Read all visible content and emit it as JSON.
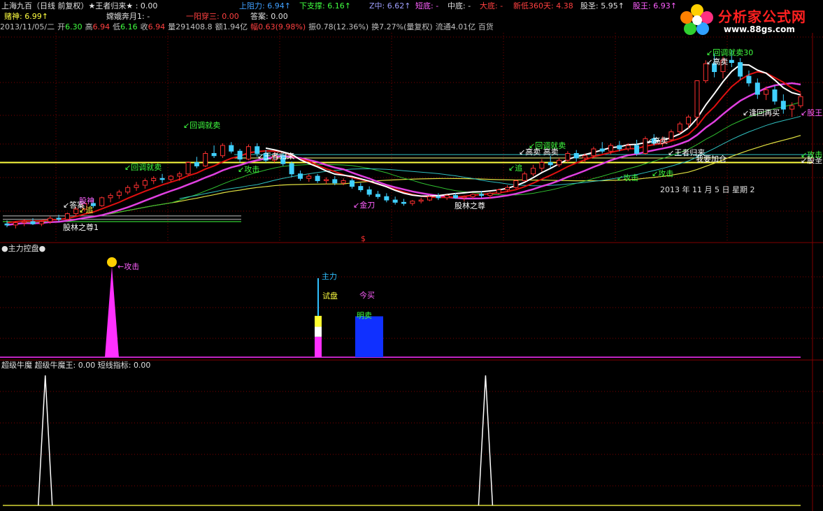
{
  "header": {
    "row1": [
      {
        "label": "上海九百（日线 前复权）★王者归来★",
        "value": ": 0.00",
        "color": "#e0e0e0"
      },
      {
        "label": "上阻力:",
        "value": "6.94",
        "arrow": "↑",
        "color": "#40a0ff"
      },
      {
        "label": "下支撑:",
        "value": "6.16",
        "arrow": "↑",
        "color": "#40ff40"
      },
      {
        "label": "Z中:",
        "value": "6.62",
        "arrow": "↑",
        "color": "#a0a0ff"
      },
      {
        "label": "短底:",
        "value": "-",
        "color": "#ff60ff"
      },
      {
        "label": "中底:",
        "value": "-",
        "color": "#e0e0e0"
      },
      {
        "label": "大底:",
        "value": "-",
        "color": "#ff4040"
      },
      {
        "label": "新低360天:",
        "value": "4.38",
        "color": "#ff4040"
      },
      {
        "label": "股圣:",
        "value": "5.95",
        "arrow": "↑",
        "color": "#e0e0e0"
      },
      {
        "label": "股王:",
        "value": "6.93",
        "arrow": "↑",
        "color": "#ff60ff"
      }
    ],
    "row2": [
      {
        "label": "赌神:",
        "value": "6.99",
        "arrow": "↑",
        "color": "#ffff40"
      },
      {
        "label": "嫦娥奔月1:",
        "value": "-",
        "color": "#e0e0e0"
      },
      {
        "label": "一阳穿三:",
        "value": "0.00",
        "color": "#ff4040"
      },
      {
        "label": "答案:",
        "value": "0.00",
        "color": "#e0e0e0"
      }
    ],
    "row3": {
      "date": "2013/11/05/二",
      "open_label": "开",
      "open": "6.30",
      "high_label": "高",
      "high": "6.94",
      "low_label": "低",
      "low": "6.16",
      "close_label": "收",
      "close": "6.94",
      "volume": "量291408.8",
      "amount": "额1.94亿",
      "change": "幅0.63(9.98%)",
      "amplitude": "振0.78(12.36%)",
      "turnover": "换7.27%(量复权)",
      "float": "流通4.01亿 百货"
    }
  },
  "logo": {
    "title": "分析家公式网",
    "url": "www.88gs.com"
  },
  "main_labels": [
    {
      "text": "↙答案",
      "color": "#ffffff",
      "k": "a1"
    },
    {
      "text": "股神",
      "color": "#ff60ff",
      "k": "a2"
    },
    {
      "text": "↙追",
      "color": "#ffff40",
      "k": "a3"
    },
    {
      "text": "股林之尊1",
      "color": "#ffffff",
      "k": "a4"
    },
    {
      "text": "↙回调就卖",
      "color": "#40ff40",
      "k": "a5"
    },
    {
      "text": "↙回调就卖",
      "color": "#40ff40",
      "k": "a6"
    },
    {
      "text": "↙王者归来",
      "color": "#ffffff",
      "k": "a7"
    },
    {
      "text": "↙金刀",
      "color": "#ff60ff",
      "k": "a8"
    },
    {
      "text": "$",
      "color": "#ff3030",
      "k": "a9"
    },
    {
      "text": "股林之尊",
      "color": "#ffffff",
      "k": "a10"
    },
    {
      "text": "↙回调就卖",
      "color": "#40ff40",
      "k": "a11"
    },
    {
      "text": "↙高卖 高卖",
      "color": "#ffffff",
      "k": "a12"
    },
    {
      "text": "↙追",
      "color": "#40ff40",
      "k": "a13"
    },
    {
      "text": "↙高卖",
      "color": "#ffffff",
      "k": "a14"
    },
    {
      "text": "↙回调就卖30",
      "color": "#40ff40",
      "k": "a15"
    },
    {
      "text": "↙高卖",
      "color": "#ffffff",
      "k": "a16"
    },
    {
      "text": "↙王者归来",
      "color": "#ffffff",
      "k": "a17"
    },
    {
      "text": "我要加仓",
      "color": "#ffffff",
      "k": "a18"
    },
    {
      "text": "↙攻击",
      "color": "#40ff40",
      "k": "a19"
    },
    {
      "text": "↙攻击",
      "color": "#40ff40",
      "k": "a20"
    },
    {
      "text": "↙逢回再买",
      "color": "#ffffff",
      "k": "a21"
    },
    {
      "text": "↙股王",
      "color": "#ff60ff",
      "k": "a22"
    },
    {
      "text": "↙攻击",
      "color": "#40ff40",
      "k": "a23"
    },
    {
      "text": "↙股圣",
      "color": "#ffffff",
      "k": "a24"
    },
    {
      "text": "↙攻击",
      "color": "#40ff40",
      "k": "a25"
    }
  ],
  "date_readout": "2013 年 11 月 5 日  星期  2",
  "pane2": {
    "title": "●主力控盘●",
    "labels": {
      "attack": "←攻击",
      "zhuli": "主力",
      "shipan": "试盘",
      "jinmai": "今买",
      "mingmai": "明卖"
    }
  },
  "pane3": {
    "title": "超级牛魔",
    "item1_label": "超级牛魔王:",
    "item1_value": "0.00",
    "item2_label": "短线指标:",
    "item2_value": "0.00"
  },
  "colors": {
    "up": "#ff3030",
    "down": "#40d0ff",
    "bg": "#000000",
    "grid": "#800000",
    "ma_red": "#e01010",
    "ma_magenta": "#e040e0",
    "ma_white": "#ffffff",
    "ma_green": "#30c030",
    "ma_yellow": "#e0e040",
    "ma_cyan": "#30c0c0"
  },
  "chart_data": [
    {
      "type": "candlestick",
      "title": "上海九百（日线 前复权）",
      "ohlc": [
        [
          4.42,
          4.48,
          4.36,
          4.4
        ],
        [
          4.4,
          4.46,
          4.34,
          4.44
        ],
        [
          4.44,
          4.5,
          4.38,
          4.46
        ],
        [
          4.46,
          4.52,
          4.4,
          4.42
        ],
        [
          4.42,
          4.48,
          4.38,
          4.46
        ],
        [
          4.46,
          4.56,
          4.42,
          4.52
        ],
        [
          4.52,
          4.58,
          4.46,
          4.5
        ],
        [
          4.5,
          4.62,
          4.48,
          4.6
        ],
        [
          4.6,
          4.72,
          4.56,
          4.68
        ],
        [
          4.68,
          4.8,
          4.64,
          4.78
        ],
        [
          4.78,
          4.86,
          4.7,
          4.74
        ],
        [
          4.74,
          4.9,
          4.72,
          4.88
        ],
        [
          4.88,
          4.96,
          4.8,
          4.92
        ],
        [
          4.92,
          5.02,
          4.86,
          4.98
        ],
        [
          4.98,
          5.1,
          4.94,
          5.06
        ],
        [
          5.06,
          5.16,
          5.0,
          5.1
        ],
        [
          5.1,
          5.22,
          5.04,
          5.18
        ],
        [
          5.18,
          5.26,
          5.12,
          5.22
        ],
        [
          5.22,
          5.3,
          5.14,
          5.2
        ],
        [
          5.2,
          5.28,
          5.16,
          5.26
        ],
        [
          5.26,
          5.34,
          5.18,
          5.3
        ],
        [
          5.3,
          5.52,
          5.28,
          5.5
        ],
        [
          5.5,
          5.6,
          5.4,
          5.44
        ],
        [
          5.44,
          5.7,
          5.42,
          5.66
        ],
        [
          5.66,
          5.8,
          5.58,
          5.62
        ],
        [
          5.62,
          5.84,
          5.58,
          5.8
        ],
        [
          5.8,
          5.86,
          5.66,
          5.7
        ],
        [
          5.7,
          5.74,
          5.5,
          5.56
        ],
        [
          5.56,
          5.82,
          5.54,
          5.78
        ],
        [
          5.78,
          5.84,
          5.6,
          5.66
        ],
        [
          5.66,
          5.72,
          5.5,
          5.54
        ],
        [
          5.54,
          5.68,
          5.5,
          5.62
        ],
        [
          5.62,
          5.66,
          5.44,
          5.48
        ],
        [
          5.48,
          5.52,
          5.24,
          5.3
        ],
        [
          5.3,
          5.36,
          5.18,
          5.22
        ],
        [
          5.22,
          5.3,
          5.16,
          5.26
        ],
        [
          5.26,
          5.3,
          5.14,
          5.18
        ],
        [
          5.18,
          5.24,
          5.12,
          5.2
        ],
        [
          5.2,
          5.26,
          5.1,
          5.14
        ],
        [
          5.14,
          5.22,
          5.1,
          5.18
        ],
        [
          5.18,
          5.22,
          5.04,
          5.08
        ],
        [
          5.08,
          5.14,
          4.98,
          5.02
        ],
        [
          5.02,
          5.08,
          4.9,
          4.94
        ],
        [
          4.94,
          5.0,
          4.86,
          4.9
        ],
        [
          4.9,
          4.96,
          4.8,
          4.84
        ],
        [
          4.84,
          4.9,
          4.76,
          4.8
        ],
        [
          4.8,
          4.86,
          4.74,
          4.78
        ],
        [
          4.78,
          4.84,
          4.74,
          4.82
        ],
        [
          4.82,
          4.88,
          4.78,
          4.84
        ],
        [
          4.84,
          4.92,
          4.82,
          4.9
        ],
        [
          4.9,
          4.96,
          4.84,
          4.88
        ],
        [
          4.88,
          4.94,
          4.84,
          4.92
        ],
        [
          4.92,
          4.96,
          4.86,
          4.88
        ],
        [
          4.88,
          4.92,
          4.82,
          4.9
        ],
        [
          4.9,
          4.96,
          4.86,
          4.94
        ],
        [
          4.94,
          5.0,
          4.88,
          4.92
        ],
        [
          4.92,
          4.98,
          4.86,
          4.96
        ],
        [
          4.96,
          5.04,
          4.94,
          5.02
        ],
        [
          5.02,
          5.1,
          4.98,
          5.06
        ],
        [
          5.06,
          5.2,
          5.04,
          5.18
        ],
        [
          5.18,
          5.34,
          5.16,
          5.3
        ],
        [
          5.3,
          5.46,
          5.26,
          5.4
        ],
        [
          5.4,
          5.56,
          5.34,
          5.5
        ],
        [
          5.5,
          5.62,
          5.4,
          5.46
        ],
        [
          5.46,
          5.58,
          5.42,
          5.54
        ],
        [
          5.54,
          5.7,
          5.5,
          5.66
        ],
        [
          5.66,
          5.72,
          5.52,
          5.58
        ],
        [
          5.58,
          5.66,
          5.5,
          5.62
        ],
        [
          5.62,
          5.78,
          5.58,
          5.74
        ],
        [
          5.74,
          5.86,
          5.66,
          5.7
        ],
        [
          5.7,
          5.84,
          5.64,
          5.8
        ],
        [
          5.8,
          5.88,
          5.7,
          5.74
        ],
        [
          5.74,
          5.84,
          5.7,
          5.8
        ],
        [
          5.8,
          5.9,
          5.62,
          5.66
        ],
        [
          5.66,
          5.96,
          5.64,
          5.92
        ],
        [
          5.92,
          6.0,
          5.8,
          5.84
        ],
        [
          5.84,
          5.96,
          5.78,
          5.9
        ],
        [
          5.9,
          6.08,
          5.88,
          6.04
        ],
        [
          6.04,
          6.22,
          6.0,
          6.18
        ],
        [
          6.18,
          6.34,
          6.1,
          6.3
        ],
        [
          6.3,
          6.94,
          6.16,
          6.94
        ],
        [
          6.94,
          7.3,
          6.9,
          7.24
        ],
        [
          7.24,
          7.42,
          7.0,
          7.1
        ],
        [
          7.1,
          7.36,
          6.98,
          7.3
        ],
        [
          7.3,
          7.48,
          7.18,
          7.26
        ],
        [
          7.26,
          7.34,
          6.96,
          7.02
        ],
        [
          7.02,
          7.12,
          6.84,
          6.9
        ],
        [
          6.9,
          6.98,
          6.62,
          6.7
        ],
        [
          6.7,
          6.84,
          6.6,
          6.78
        ],
        [
          6.78,
          6.86,
          6.52,
          6.58
        ],
        [
          6.58,
          6.7,
          6.36,
          6.44
        ],
        [
          6.44,
          6.56,
          6.3,
          6.5
        ],
        [
          6.5,
          6.72,
          6.46,
          6.66
        ]
      ],
      "moving_averages": [
        "red",
        "magenta",
        "white",
        "green",
        "yellow",
        "cyan"
      ]
    },
    {
      "type": "bar",
      "title": "●主力控盘●",
      "bars": [
        {
          "name": "攻击",
          "value": 1.0,
          "color": "#ff30ff"
        },
        {
          "name": "主力/试盘",
          "segments": [
            0.45,
            0.22,
            0.24
          ],
          "colors": [
            "#ff30ff",
            "#ffffff",
            "#ffff30"
          ]
        },
        {
          "name": "今买/明卖",
          "value": 0.45,
          "color": "#1030ff"
        }
      ]
    },
    {
      "type": "line",
      "title": "超级牛魔",
      "series": [
        {
          "name": "超级牛魔王",
          "spikes_at": [
            0.055,
            0.59
          ],
          "value": 0.0
        },
        {
          "name": "短线指标",
          "value": 0.0
        }
      ]
    }
  ]
}
